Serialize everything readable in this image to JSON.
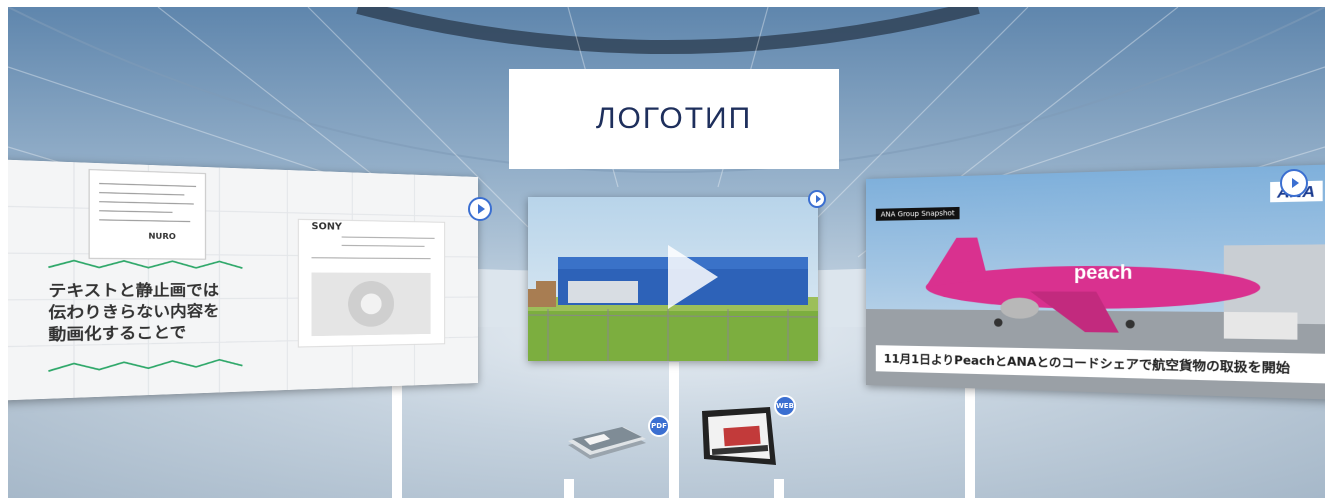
{
  "logo": {
    "text": "ЛОГОТИП"
  },
  "left_panel": {
    "doc_brand": "SONY",
    "doc_product": "NURO",
    "slide_lines": [
      "テキストと静止画では",
      "伝わりきらない内容を",
      "動画化することで"
    ]
  },
  "center_panel": {
    "video": "play-video"
  },
  "right_panel": {
    "header_tag": "ANA Group Snapshot",
    "brand": "ANA",
    "plane_livery": "peach",
    "caption": "11月1日よりPeachとANAとのコードシェアで航空貨物の取扱を開始"
  },
  "pdf_item": {
    "badge": "PDF"
  },
  "web_item": {
    "badge": "WEB"
  },
  "colors": {
    "accent": "#3b6fd1",
    "logo_text": "#1e2f5c",
    "peach_pink": "#d9318f"
  }
}
